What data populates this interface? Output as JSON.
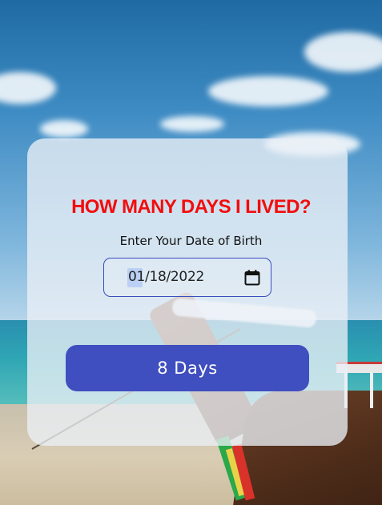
{
  "app": {
    "title": "HOW MANY DAYS I LIVED?",
    "title_color": "#f20d0d",
    "accent_color": "#3f4fc0"
  },
  "form": {
    "dob_label": "Enter Your Date of Birth",
    "dob_value": "01/18/2022",
    "dob_highlight_segment": "01",
    "calendar_icon": "calendar-icon"
  },
  "result": {
    "label": "8 Days"
  }
}
